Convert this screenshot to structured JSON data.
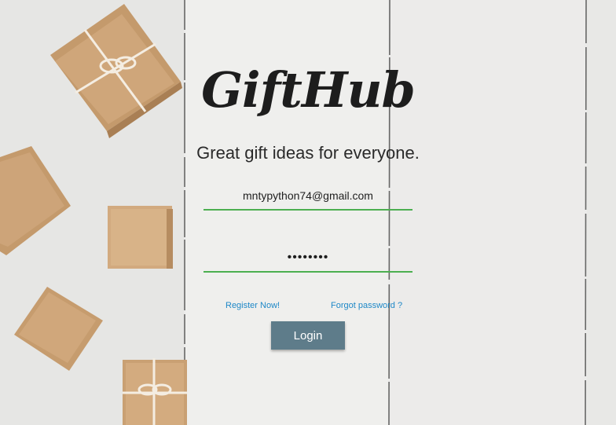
{
  "brand": {
    "name": "GiftHub"
  },
  "tagline": "Great gift ideas for everyone.",
  "login_form": {
    "email_value": "mntypython74@gmail.com",
    "password_masked": "••••••••",
    "register_link": "Register Now!",
    "forgot_link": "Forgot password ?",
    "login_button": "Login"
  },
  "colors": {
    "input_underline": "#4caf50",
    "link": "#1e88c7",
    "button_bg": "#5e7c8a"
  }
}
